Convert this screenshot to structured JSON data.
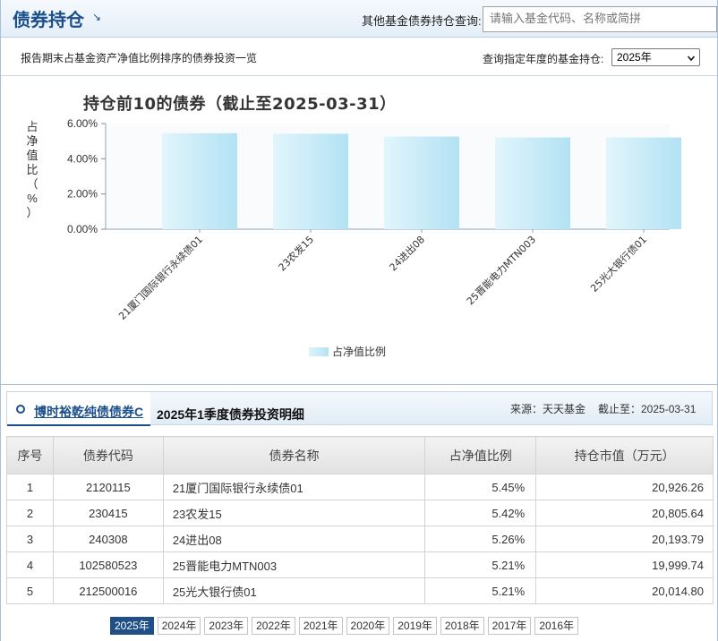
{
  "header": {
    "title": "债券持仓",
    "search_label": "其他基金债券持仓查询:",
    "search_placeholder": "请输入基金代码、名称或简拼"
  },
  "subbar": {
    "description": "报告期末占基金资产净值比例排序的债券投资一览",
    "year_label": "查询指定年度的基金持仓:",
    "selected_year": "2025年"
  },
  "chart_data": {
    "type": "bar",
    "title": "持仓前10的债券（截止至2025-03-31）",
    "ylabel": "占净值比（%）",
    "ylabel_chars": [
      "占",
      "净",
      "值",
      "比",
      "（",
      "%",
      "）"
    ],
    "categories": [
      "21厦门国际银行永续债01",
      "23农发15",
      "24进出08",
      "25晋能电力MTN003",
      "25光大银行债01"
    ],
    "series": [
      {
        "name": "占净值比例",
        "values": [
          5.45,
          5.42,
          5.26,
          5.21,
          5.21
        ]
      }
    ],
    "ylim": [
      0,
      6
    ],
    "yticks": [
      "0.00%",
      "2.00%",
      "4.00%",
      "6.00%"
    ],
    "grid": false,
    "legend": "bottom-center",
    "bar_color": "#c8ecf8"
  },
  "panel": {
    "fund_name": "博时裕乾纯债债券C",
    "period_title": "2025年1季度债券投资明细",
    "source": "来源：天天基金",
    "as_of": "截止至：2025-03-31"
  },
  "table": {
    "headers": [
      "序号",
      "债券代码",
      "债券名称",
      "占净值比例",
      "持仓市值（万元）"
    ],
    "rows": [
      [
        "1",
        "2120115",
        "21厦门国际银行永续债01",
        "5.45%",
        "20,926.26"
      ],
      [
        "2",
        "230415",
        "23农发15",
        "5.42%",
        "20,805.64"
      ],
      [
        "3",
        "240308",
        "24进出08",
        "5.26%",
        "20,193.79"
      ],
      [
        "4",
        "102580523",
        "25晋能电力MTN003",
        "5.21%",
        "19,999.74"
      ],
      [
        "5",
        "212500016",
        "25光大银行债01",
        "5.21%",
        "20,014.80"
      ]
    ]
  },
  "years": [
    "2025年",
    "2024年",
    "2023年",
    "2022年",
    "2021年",
    "2020年",
    "2019年",
    "2018年",
    "2017年",
    "2016年"
  ],
  "active_year_index": 0,
  "colors": {
    "brand": "#1b4f8b",
    "active_year": "#1f4f86"
  }
}
